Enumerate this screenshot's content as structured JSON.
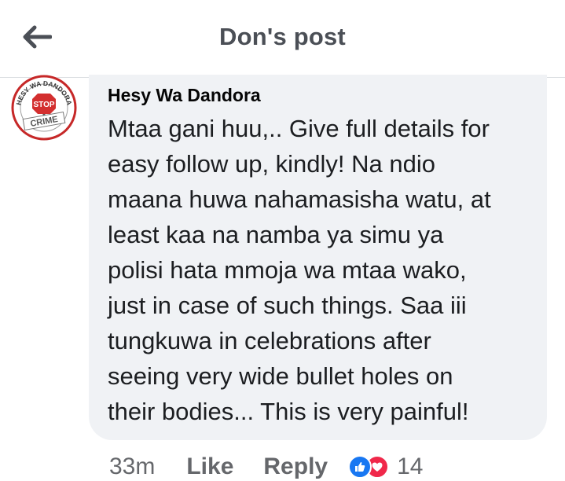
{
  "header": {
    "back_icon": "arrow-left-icon",
    "title": "Don's post"
  },
  "comment": {
    "avatar": {
      "icon": "stop-crime-logo",
      "text_top": "HESY WA DANDORA",
      "text_stop": "STOP",
      "text_crime": "CRIME",
      "colors": {
        "ring": "#c62828",
        "stop": "#d32f2f"
      }
    },
    "author": "Hesy Wa Dandora",
    "text_lines": [
      "Mtaa gani huu,.. Give full details for",
      "easy follow up, kindly! Na ndio",
      "maana huwa nahamasisha watu, at",
      "least kaa na namba ya simu ya",
      "polisi hata mmoja wa mtaa wako,",
      "just in case of such things. Saa iii",
      "tungkuwa in celebrations after",
      "seeing very wide bullet holes on",
      "their bodies... This is very painful!"
    ],
    "timestamp": "33m",
    "like_label": "Like",
    "reply_label": "Reply",
    "reactions": [
      {
        "icon": "thumbs-up-icon",
        "color": "#1877f2"
      },
      {
        "icon": "heart-icon",
        "color": "#f0284a"
      }
    ],
    "reaction_count": "14"
  }
}
